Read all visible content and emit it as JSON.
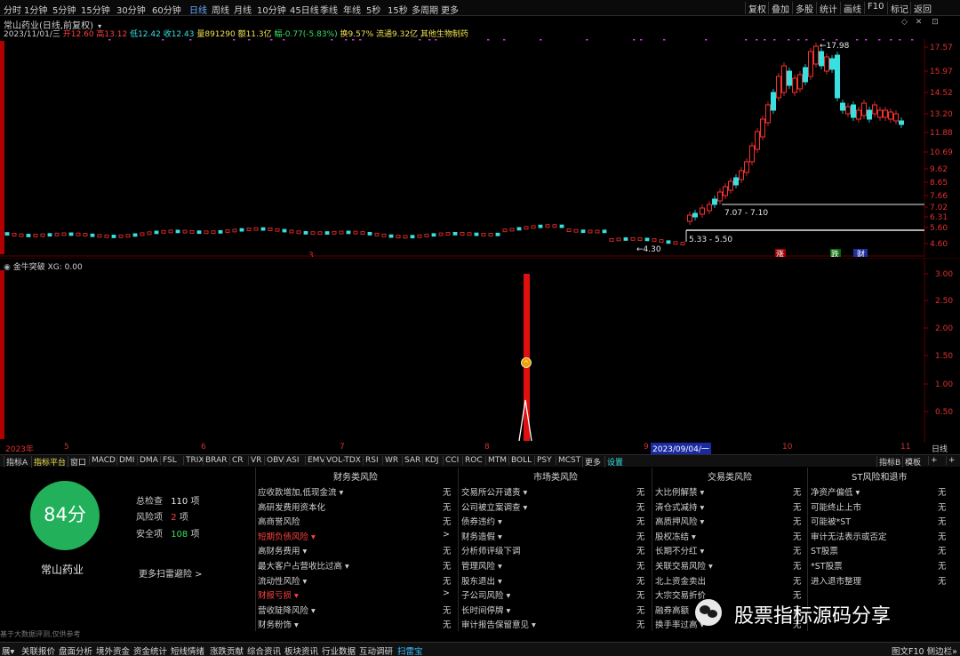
{
  "toolbar": {
    "timeframes": [
      "分时",
      "1分钟",
      "5分钟",
      "15分钟",
      "30分钟",
      "60分钟",
      "日线",
      "周线",
      "月线",
      "10分钟",
      "45日线",
      "季线",
      "年线",
      "5秒",
      "15秒",
      "多周期",
      "更多"
    ],
    "right_buttons": [
      "复权",
      "叠加",
      "多股",
      "统计",
      "画线",
      "F10",
      "标记",
      "返回"
    ]
  },
  "header": {
    "line1": "常山药业(日线,前复权)",
    "date": "2023/11/01/三",
    "open": "开12.60",
    "high": "高13.12",
    "low": "低12.42",
    "close": "收12.43",
    "volume": "量891290",
    "amount": "额11.3亿",
    "change": "幅-0.77(-5.83%)",
    "turnover": "换9.57%",
    "float": "流通9.32亿",
    "sector": "其他生物制药"
  },
  "price_axis": [
    "17.57",
    "15.97",
    "14.52",
    "13.20",
    "11.88",
    "10.69",
    "9.62",
    "8.65",
    "7.66",
    "7.02",
    "6.31",
    "5.60",
    "4.60"
  ],
  "price_annotations": {
    "high_mark": "17.98",
    "low_mark": "4.30",
    "band_upper": "7.07 - 7.10",
    "band_lower": "5.33 - 5.50",
    "badge_zhang": "涨",
    "badge_die": "跌",
    "badge_cai": "财",
    "marker_3": "3"
  },
  "indicator": {
    "title": "金牛突破 XG: 0.00",
    "axis": [
      "3.00",
      "2.50",
      "2.00",
      "1.50",
      "1.00",
      "0.50"
    ]
  },
  "date_axis": {
    "labels": [
      "2023年",
      "5",
      "6",
      "7",
      "8",
      "9",
      "10",
      "11"
    ],
    "current": "2023/09/04/一",
    "mode": "日线"
  },
  "tabs": [
    "指标A",
    "指标平台",
    "窗口",
    "MACD",
    "DMI",
    "DMA",
    "FSL",
    "TRIX",
    "BRAR",
    "CR",
    "VR",
    "OBV",
    "ASI",
    "EMV",
    "VOL-TDX",
    "RSI",
    "WR",
    "SAR",
    "KDJ",
    "CCI",
    "ROC",
    "MTM",
    "BOLL",
    "PSY",
    "MCST",
    "更多",
    "设置"
  ],
  "tabs_right": [
    "指标B",
    "模板"
  ],
  "score": {
    "value": "84分",
    "name": "常山药业",
    "total_label": "总检查",
    "total_value": "110",
    "total_unit": "项",
    "risk_label": "风险项",
    "risk_value": "2",
    "risk_unit": "项",
    "safe_label": "安全项",
    "safe_value": "108",
    "safe_unit": "项",
    "more_link": "更多扫雷避险 >",
    "footnote": "基于大数据评测,仅供参考"
  },
  "columns": [
    {
      "title": "财务类风险",
      "items": [
        {
          "label": "应收款增加,低现金流 ▾",
          "value": "无",
          "red": false
        },
        {
          "label": "高研发费用资本化",
          "value": "无",
          "red": false
        },
        {
          "label": "高商誉风险",
          "value": "无",
          "red": false
        },
        {
          "label": "短期负债风险 ▾",
          "value": ">",
          "red": true
        },
        {
          "label": "高财务费用 ▾",
          "value": "无",
          "red": false
        },
        {
          "label": "最大客户占营收比过高 ▾",
          "value": "无",
          "red": false
        },
        {
          "label": "流动性风险 ▾",
          "value": "无",
          "red": false
        },
        {
          "label": "财报亏损 ▾",
          "value": ">",
          "red": true
        },
        {
          "label": "营收陡降风险 ▾",
          "value": "无",
          "red": false
        },
        {
          "label": "财务粉饰 ▾",
          "value": "无",
          "red": false
        }
      ]
    },
    {
      "title": "市场类风险",
      "items": [
        {
          "label": "交易所公开谴责 ▾",
          "value": "无",
          "red": false
        },
        {
          "label": "公司被立案调查 ▾",
          "value": "无",
          "red": false
        },
        {
          "label": "债券违约 ▾",
          "value": "无",
          "red": false
        },
        {
          "label": "财务造假 ▾",
          "value": "无",
          "red": false
        },
        {
          "label": "分析师评级下调",
          "value": "无",
          "red": false
        },
        {
          "label": "管理风险 ▾",
          "value": "无",
          "red": false
        },
        {
          "label": "股东退出 ▾",
          "value": "无",
          "red": false
        },
        {
          "label": "子公司风险 ▾",
          "value": "无",
          "red": false
        },
        {
          "label": "长时间停牌 ▾",
          "value": "无",
          "red": false
        },
        {
          "label": "审计报告保留意见 ▾",
          "value": "无",
          "red": false
        }
      ]
    },
    {
      "title": "交易类风险",
      "items": [
        {
          "label": "大比例解禁 ▾",
          "value": "无",
          "red": false
        },
        {
          "label": "清仓式减持 ▾",
          "value": "无",
          "red": false
        },
        {
          "label": "高质押风险 ▾",
          "value": "无",
          "red": false
        },
        {
          "label": "股权冻结 ▾",
          "value": "无",
          "red": false
        },
        {
          "label": "长期不分红 ▾",
          "value": "无",
          "red": false
        },
        {
          "label": "关联交易风险 ▾",
          "value": "无",
          "red": false
        },
        {
          "label": "北上资金卖出",
          "value": "无",
          "red": false
        },
        {
          "label": "大宗交易折价",
          "value": "无",
          "red": false
        },
        {
          "label": "融券高额",
          "value": "无",
          "red": false
        },
        {
          "label": "换手率过高 ▾",
          "value": "无",
          "red": false
        }
      ]
    },
    {
      "title": "ST风险和退市",
      "items": [
        {
          "label": "净资产偏低 ▾",
          "value": "无",
          "red": false
        },
        {
          "label": "可能终止上市",
          "value": "无",
          "red": false
        },
        {
          "label": "可能被*ST",
          "value": "无",
          "red": false
        },
        {
          "label": "审计无法表示或否定",
          "value": "无",
          "red": false
        },
        {
          "label": "ST股票",
          "value": "无",
          "red": false
        },
        {
          "label": "*ST股票",
          "value": "无",
          "red": false
        },
        {
          "label": "进入退市整理",
          "value": "无",
          "red": false
        }
      ]
    }
  ],
  "watermark": "股票指标源码分享",
  "bottom_tabs": [
    "展▾",
    "关联报价",
    "盘面分析",
    "境外资金",
    "资金统计",
    "短线情绪",
    "涨跌贡献",
    "综合资讯",
    "板块资讯",
    "行业数据",
    "互动调研",
    "扫雷宝"
  ],
  "bottom_right": "图文F10 侧边栏»",
  "colors": {
    "up": "#ff3030",
    "down": "#38e0e0",
    "score_circle": "#22b05a",
    "signal_bar": "#e01010"
  }
}
